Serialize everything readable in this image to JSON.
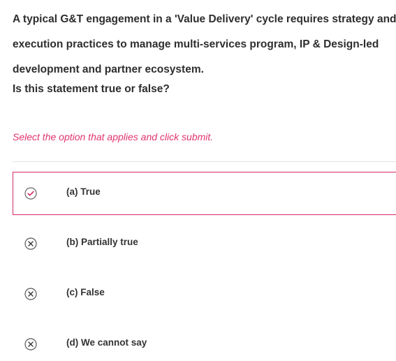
{
  "question": {
    "lines": [
      "A typical G&T engagement in a 'Value Delivery' cycle requires strategy and",
      "execution practices to manage multi-services program, IP & Design-led",
      "development and partner ecosystem.",
      "Is this statement true or false?"
    ]
  },
  "instruction": "Select the option that applies and click submit.",
  "options": [
    {
      "label": "(a) True",
      "state": "selected",
      "icon": "check-circle-icon"
    },
    {
      "label": "(b) Partially true",
      "state": "unselected",
      "icon": "x-circle-icon"
    },
    {
      "label": "(c) False",
      "state": "unselected",
      "icon": "x-circle-icon"
    },
    {
      "label": "(d) We cannot say",
      "state": "unselected",
      "icon": "x-circle-icon"
    }
  ],
  "colors": {
    "accent": "#e0336f",
    "selected_border": "#d6286a",
    "icon_gray": "#555555",
    "text": "#2e2e2e"
  }
}
